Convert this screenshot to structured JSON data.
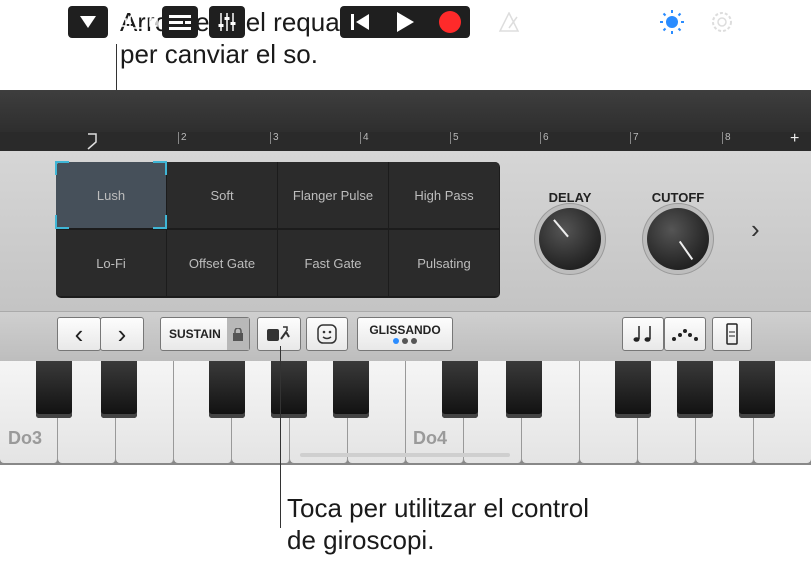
{
  "callouts": {
    "top": "Arrossega el requadre\nper canviar el so.",
    "bottom": "Toca per utilitzar el control\nde giroscopi."
  },
  "toolbar": {
    "icons": [
      "menu-triangle-icon",
      "view-toggle-icon",
      "tracks-icon",
      "mixer-icon",
      "rewind-icon",
      "play-icon",
      "record-icon",
      "metronome-icon",
      "brightness-icon",
      "settings-icon"
    ]
  },
  "ruler": {
    "ticks": [
      "2",
      "3",
      "4",
      "5",
      "6",
      "7",
      "8"
    ],
    "add": "+"
  },
  "sounds": {
    "cells": [
      "Lush",
      "Soft",
      "Flanger Pulse",
      "High Pass",
      "Lo-Fi",
      "Offset Gate",
      "Fast Gate",
      "Pulsating"
    ],
    "selected": "Lush"
  },
  "knobs": [
    {
      "label": "DELAY",
      "value": 0.2
    },
    {
      "label": "CUTOFF",
      "value": 0.75
    }
  ],
  "next_arrow": "›",
  "controls": {
    "prev": "‹",
    "next": "›",
    "sustain": "SUSTAIN",
    "glissando": "GLISSANDO"
  },
  "keyboard": {
    "labels": [
      "Do3",
      "Do4"
    ]
  },
  "colors": {
    "record": "#ff2a2a",
    "accent": "#2a8cff",
    "selection": "#3fb6d6"
  }
}
